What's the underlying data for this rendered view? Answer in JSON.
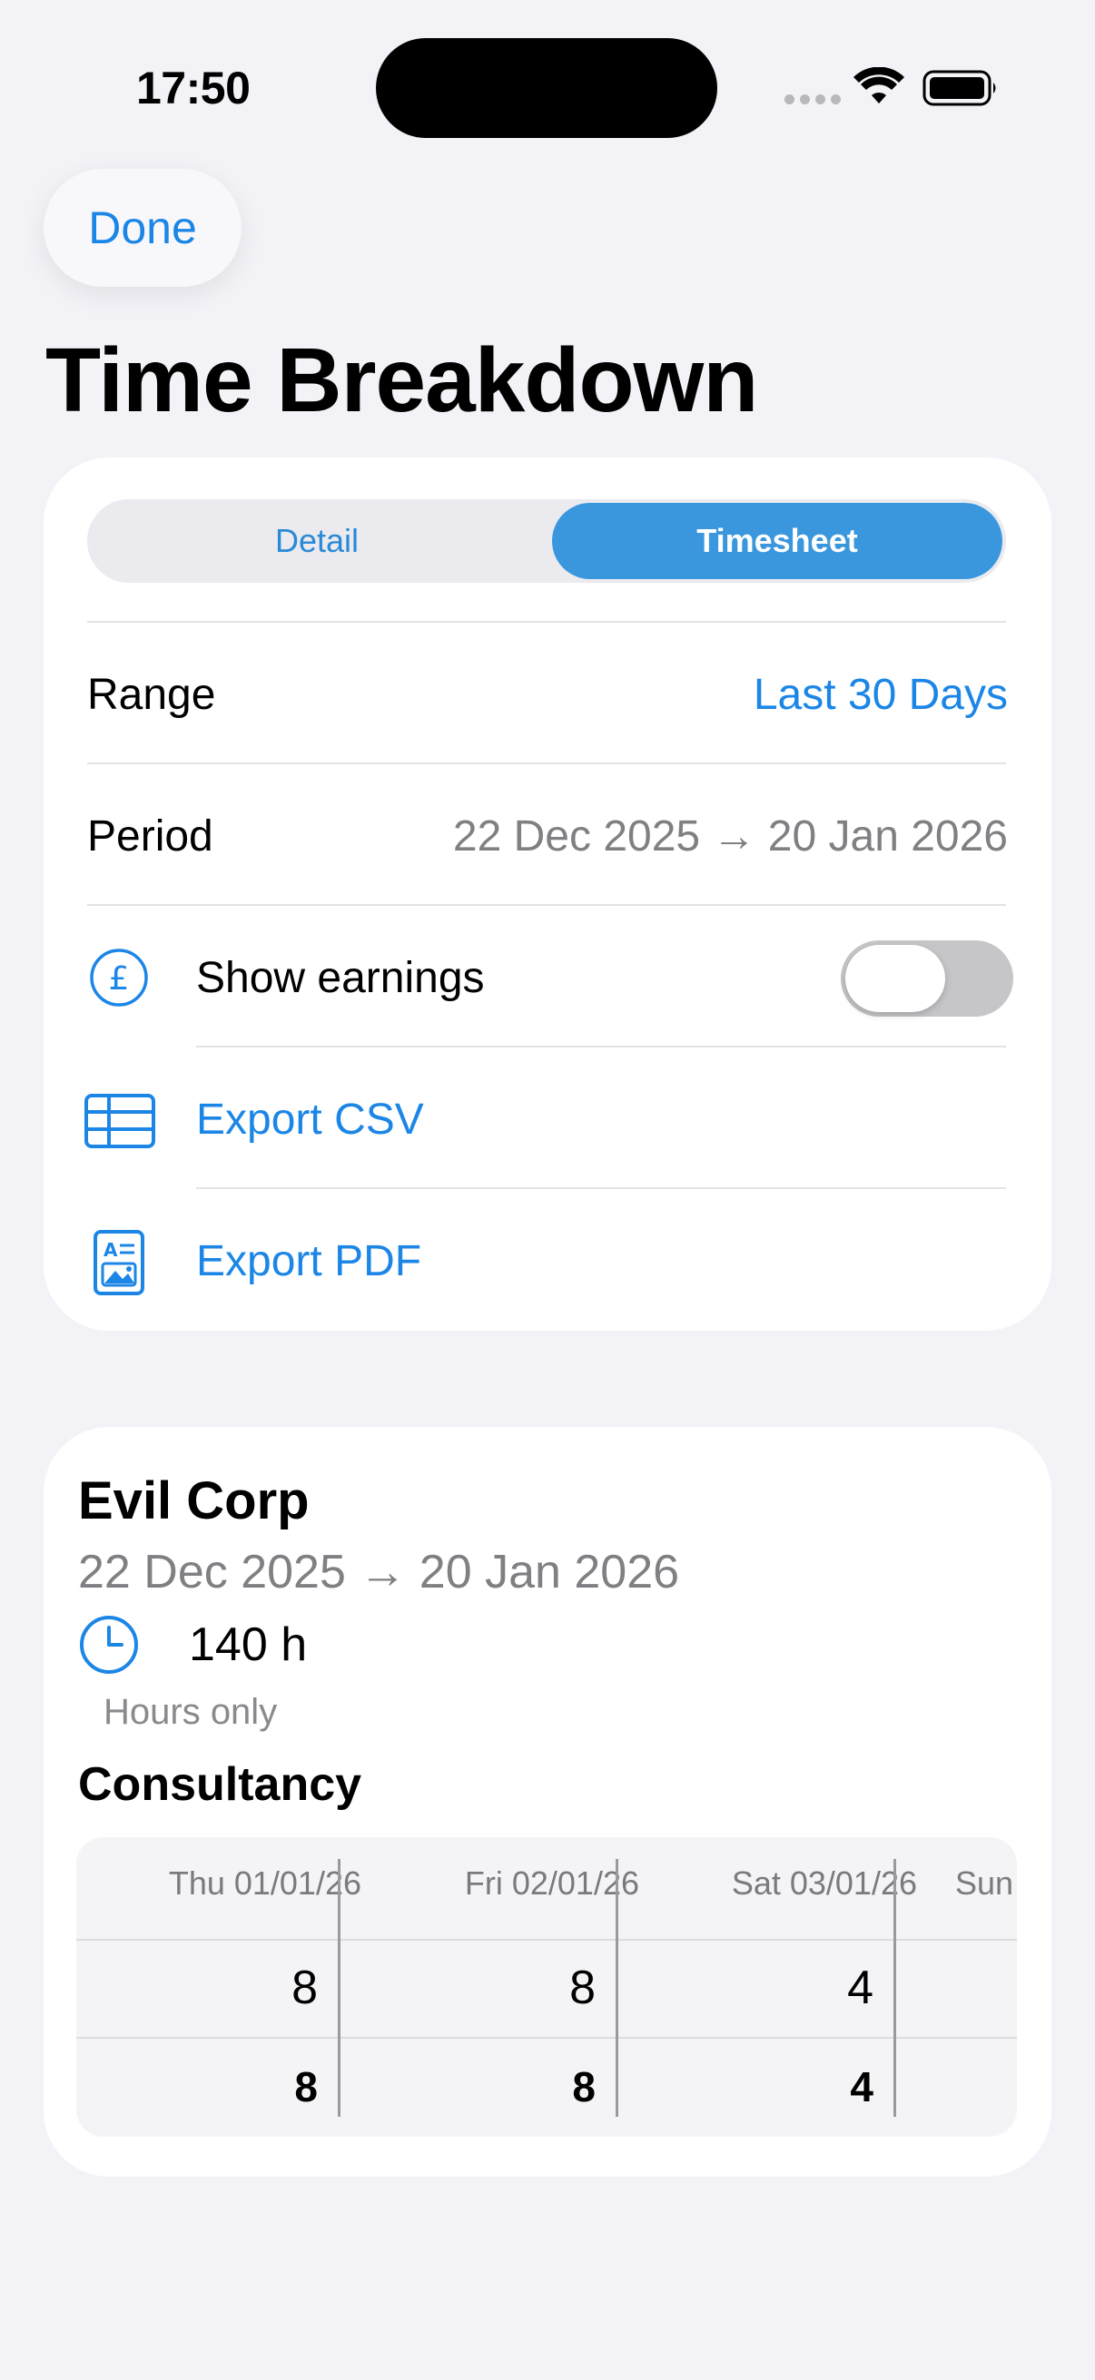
{
  "status_bar": {
    "time": "17:50"
  },
  "nav": {
    "done_label": "Done",
    "title": "Time Breakdown"
  },
  "segmented": {
    "detail_label": "Detail",
    "timesheet_label": "Timesheet",
    "selected": "Timesheet"
  },
  "settings": {
    "range_label": "Range",
    "range_value": "Last 30 Days",
    "period_label": "Period",
    "period_value": "22 Dec 2025 → 20 Jan 2026",
    "show_earnings_label": "Show earnings",
    "show_earnings_on": false,
    "export_csv_label": "Export CSV",
    "export_pdf_label": "Export PDF",
    "currency_icon": "pound-sign-icon"
  },
  "summary": {
    "company": "Evil Corp",
    "period": "22 Dec 2025 → 20 Jan 2026",
    "hours": "140 h",
    "hours_note": "Hours only",
    "project": "Consultancy"
  },
  "timesheet": {
    "columns": [
      "Thu 01/01/26",
      "Fri 02/01/26",
      "Sat 03/01/26",
      "Sun"
    ],
    "rows": [
      [
        "8",
        "8",
        "4",
        ""
      ],
      [
        "8",
        "8",
        "4",
        ""
      ]
    ]
  },
  "colors": {
    "accent": "#1c86e6",
    "segment_selected": "#3a97dd",
    "background": "#f2f2f7"
  }
}
